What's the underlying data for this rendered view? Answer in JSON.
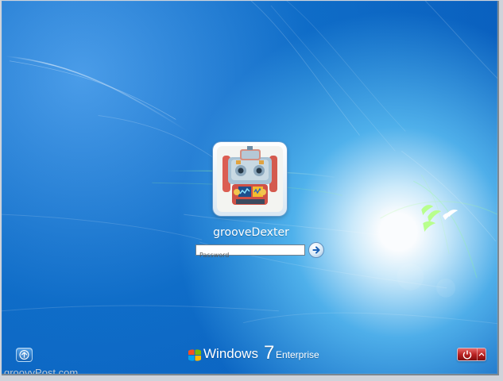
{
  "login": {
    "username": "grooveDexter",
    "password_placeholder": "Password",
    "password_value": ""
  },
  "footer": {
    "brand_name": "Windows",
    "brand_version": "7",
    "brand_edition": "Enterprise",
    "watermark": "groovyPost.com"
  },
  "icons": {
    "avatar": "robot-avatar-icon",
    "submit": "arrow-right-icon",
    "ease_of_access": "ease-of-access-icon",
    "shutdown": "power-icon",
    "shutdown_options": "chevron-up-icon",
    "windows_logo": "windows-logo-icon",
    "birds": "birds-icon"
  },
  "colors": {
    "background_blue": "#0b74cf",
    "highlight": "#ffffff",
    "shutdown_red": "#b51e1e"
  }
}
